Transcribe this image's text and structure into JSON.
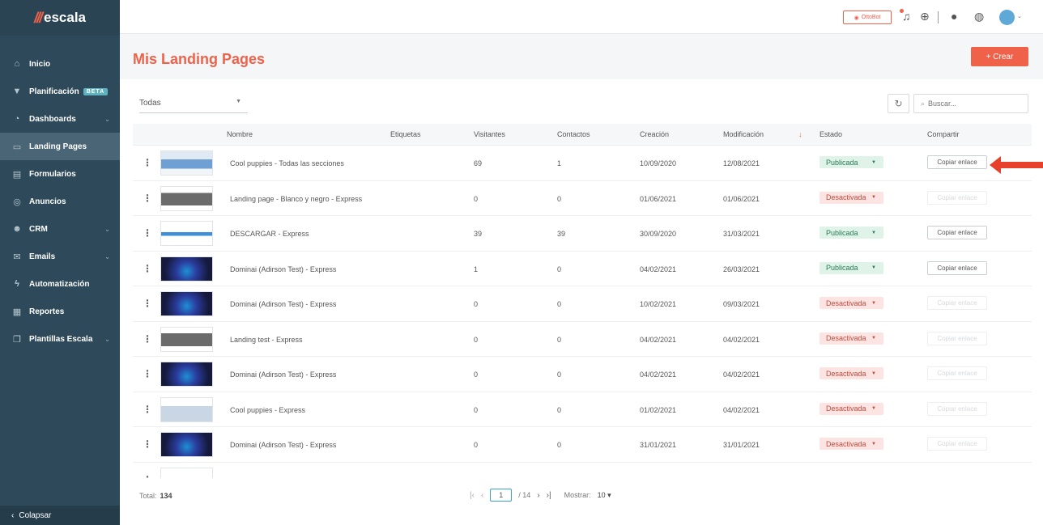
{
  "app": {
    "logo_text": "escala"
  },
  "sidebar": {
    "items": [
      {
        "label": "Inicio",
        "icon": "home-icon",
        "glyph": "⌂",
        "chevron": false,
        "active": false
      },
      {
        "label": "Planificación",
        "icon": "filter-icon",
        "glyph": "▼",
        "chevron": false,
        "active": false,
        "badge": "BETA"
      },
      {
        "label": "Dashboards",
        "icon": "pie-chart-icon",
        "glyph": "◔",
        "chevron": true,
        "active": false
      },
      {
        "label": "Landing Pages",
        "icon": "landing-page-icon",
        "glyph": "▭",
        "chevron": false,
        "active": true
      },
      {
        "label": "Formularios",
        "icon": "form-icon",
        "glyph": "▤",
        "chevron": false,
        "active": false
      },
      {
        "label": "Anuncios",
        "icon": "target-icon",
        "glyph": "◎",
        "chevron": false,
        "active": false
      },
      {
        "label": "CRM",
        "icon": "users-icon",
        "glyph": "☻",
        "chevron": true,
        "active": false
      },
      {
        "label": "Emails",
        "icon": "mail-icon",
        "glyph": "✉",
        "chevron": true,
        "active": false
      },
      {
        "label": "Automatización",
        "icon": "lightning-icon",
        "glyph": "ϟ",
        "chevron": false,
        "active": false
      },
      {
        "label": "Reportes",
        "icon": "report-icon",
        "glyph": "▦",
        "chevron": false,
        "active": false
      },
      {
        "label": "Plantillas Escala",
        "icon": "template-icon",
        "glyph": "❐",
        "chevron": true,
        "active": false
      }
    ],
    "collapse_label": "Colapsar"
  },
  "topbar": {
    "ottobot_label": "OttoBot"
  },
  "main": {
    "title": "Mis Landing Pages",
    "create_label": "+ Crear",
    "filter_value": "Todas",
    "search_placeholder": "Buscar..."
  },
  "table": {
    "headers": {
      "nombre": "Nombre",
      "etiquetas": "Etiquetas",
      "visitantes": "Visitantes",
      "contactos": "Contactos",
      "creacion": "Creación",
      "modificacion": "Modificación",
      "estado": "Estado",
      "compartir": "Compartir"
    },
    "share_label": "Copiar enlace",
    "rows": [
      {
        "thumb": "blue",
        "name": "Cool puppies - Todas las secciones",
        "visitors": "69",
        "contacts": "1",
        "created": "10/09/2020",
        "modified": "12/08/2021",
        "status": "Publicada",
        "published": true
      },
      {
        "thumb": "gray",
        "name": "Landing page - Blanco y negro - Express",
        "visitors": "0",
        "contacts": "0",
        "created": "01/06/2021",
        "modified": "01/06/2021",
        "status": "Desactivada",
        "published": false
      },
      {
        "thumb": "white",
        "name": "DESCARGAR - Express",
        "visitors": "39",
        "contacts": "39",
        "created": "30/09/2020",
        "modified": "31/03/2021",
        "status": "Publicada",
        "published": true
      },
      {
        "thumb": "dark",
        "name": "Dominai (Adirson Test) - Express",
        "visitors": "1",
        "contacts": "0",
        "created": "04/02/2021",
        "modified": "26/03/2021",
        "status": "Publicada",
        "published": true
      },
      {
        "thumb": "dark",
        "name": "Dominai (Adirson Test) - Express",
        "visitors": "0",
        "contacts": "0",
        "created": "10/02/2021",
        "modified": "09/03/2021",
        "status": "Desactivada",
        "published": false
      },
      {
        "thumb": "gray",
        "name": "Landing test - Express",
        "visitors": "0",
        "contacts": "0",
        "created": "04/02/2021",
        "modified": "04/02/2021",
        "status": "Desactivada",
        "published": false
      },
      {
        "thumb": "dark",
        "name": "Dominai (Adirson Test) - Express",
        "visitors": "0",
        "contacts": "0",
        "created": "04/02/2021",
        "modified": "04/02/2021",
        "status": "Desactivada",
        "published": false
      },
      {
        "thumb": "pups",
        "name": "Cool puppies - Express",
        "visitors": "0",
        "contacts": "0",
        "created": "01/02/2021",
        "modified": "04/02/2021",
        "status": "Desactivada",
        "published": false
      },
      {
        "thumb": "dark",
        "name": "Dominai (Adirson Test) - Express",
        "visitors": "0",
        "contacts": "0",
        "created": "31/01/2021",
        "modified": "31/01/2021",
        "status": "Desactivada",
        "published": false
      },
      {
        "thumb": "white",
        "name": "",
        "visitors": "",
        "contacts": "",
        "created": "",
        "modified": "",
        "status": "",
        "published": false
      }
    ]
  },
  "footer": {
    "total_label": "Total:",
    "total_value": "134",
    "current_page": "1",
    "of_pages": "/ 14",
    "show_label": "Mostrar:",
    "show_value": "10"
  },
  "colors": {
    "accent": "#f0614a",
    "sidebar": "#2e4a5a",
    "published": "#2a7b54",
    "deactivated": "#c64a3d"
  }
}
